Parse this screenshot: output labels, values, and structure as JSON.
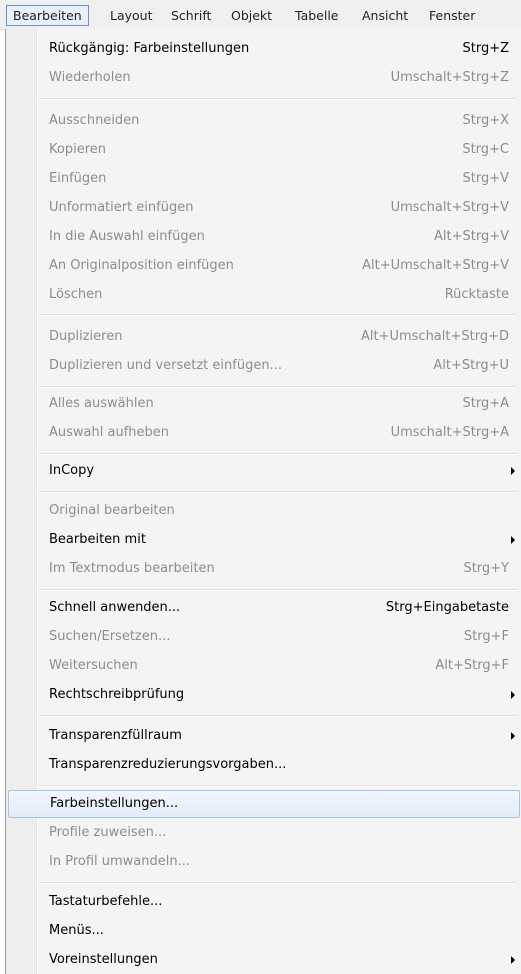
{
  "menubar": {
    "items": [
      "Bearbeiten",
      "Layout",
      "Schrift",
      "Objekt",
      "Tabelle",
      "Ansicht",
      "Fenster"
    ],
    "active": "Bearbeiten"
  },
  "menu": {
    "items": [
      {
        "label": "Rückgängig: Farbeinstellungen",
        "shortcut": "Strg+Z",
        "enabled": true
      },
      {
        "label": "Wiederholen",
        "shortcut": "Umschalt+Strg+Z",
        "enabled": false
      },
      {
        "label": "Ausschneiden",
        "shortcut": "Strg+X",
        "enabled": false
      },
      {
        "label": "Kopieren",
        "shortcut": "Strg+C",
        "enabled": false
      },
      {
        "label": "Einfügen",
        "shortcut": "Strg+V",
        "enabled": false
      },
      {
        "label": "Unformatiert einfügen",
        "shortcut": "Umschalt+Strg+V",
        "enabled": false
      },
      {
        "label": "In die Auswahl einfügen",
        "shortcut": "Alt+Strg+V",
        "enabled": false
      },
      {
        "label": "An Originalposition einfügen",
        "shortcut": "Alt+Umschalt+Strg+V",
        "enabled": false
      },
      {
        "label": "Löschen",
        "shortcut": "Rücktaste",
        "enabled": false
      },
      {
        "label": "Duplizieren",
        "shortcut": "Alt+Umschalt+Strg+D",
        "enabled": false
      },
      {
        "label": "Duplizieren und versetzt einfügen...",
        "shortcut": "Alt+Strg+U",
        "enabled": false
      },
      {
        "label": "Alles auswählen",
        "shortcut": "Strg+A",
        "enabled": false
      },
      {
        "label": "Auswahl aufheben",
        "shortcut": "Umschalt+Strg+A",
        "enabled": false
      },
      {
        "label": "InCopy",
        "shortcut": "",
        "enabled": true,
        "submenu": true
      },
      {
        "label": "Original bearbeiten",
        "shortcut": "",
        "enabled": false
      },
      {
        "label": "Bearbeiten mit",
        "shortcut": "",
        "enabled": true,
        "submenu": true
      },
      {
        "label": "Im Textmodus bearbeiten",
        "shortcut": "Strg+Y",
        "enabled": false
      },
      {
        "label": "Schnell anwenden...",
        "shortcut": "Strg+Eingabetaste",
        "enabled": true
      },
      {
        "label": "Suchen/Ersetzen...",
        "shortcut": "Strg+F",
        "enabled": false
      },
      {
        "label": "Weitersuchen",
        "shortcut": "Alt+Strg+F",
        "enabled": false
      },
      {
        "label": "Rechtschreibprüfung",
        "shortcut": "",
        "enabled": true,
        "submenu": true
      },
      {
        "label": "Transparenzfüllraum",
        "shortcut": "",
        "enabled": true,
        "submenu": true
      },
      {
        "label": "Transparenzreduzierungsvorgaben...",
        "shortcut": "",
        "enabled": true
      },
      {
        "label": "Farbeinstellungen...",
        "shortcut": "",
        "enabled": true,
        "hovered": true
      },
      {
        "label": "Profile zuweisen...",
        "shortcut": "",
        "enabled": false
      },
      {
        "label": "In Profil umwandeln...",
        "shortcut": "",
        "enabled": false
      },
      {
        "label": "Tastaturbefehle...",
        "shortcut": "",
        "enabled": true
      },
      {
        "label": "Menüs...",
        "shortcut": "",
        "enabled": true
      },
      {
        "label": "Voreinstellungen",
        "shortcut": "",
        "enabled": true,
        "submenu": true
      }
    ]
  }
}
